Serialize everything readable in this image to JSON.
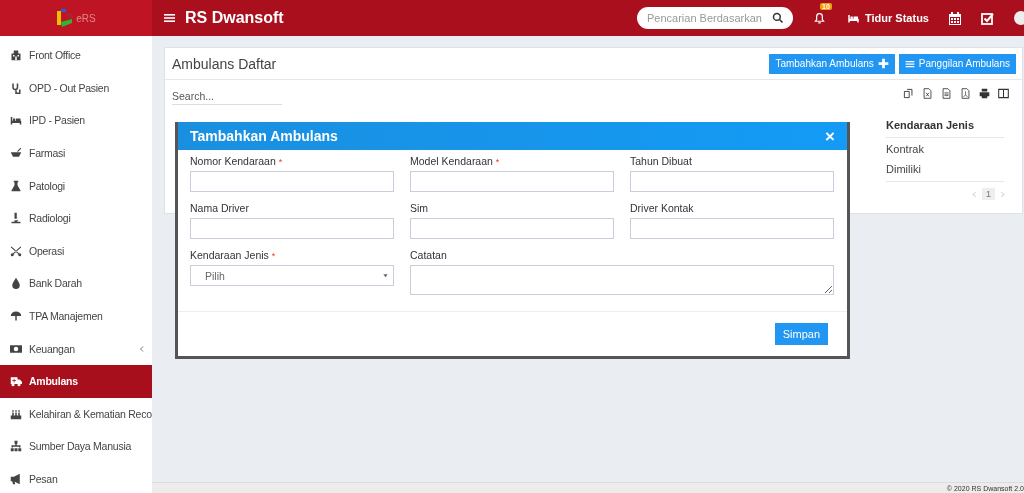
{
  "header": {
    "logo_text": "eRS",
    "title": "RS Dwansoft",
    "search": {
      "placeholder": "Pencarian Berdasarkan"
    },
    "notification_count": "10",
    "bed_status": "Tidur Status"
  },
  "sidebar": {
    "items": [
      {
        "label": "Front Office",
        "selected": false,
        "has_submenu": false
      },
      {
        "label": "OPD - Out Pasien",
        "selected": false,
        "has_submenu": false
      },
      {
        "label": "IPD - Pasien",
        "selected": false,
        "has_submenu": false
      },
      {
        "label": "Farmasi",
        "selected": false,
        "has_submenu": false
      },
      {
        "label": "Patologi",
        "selected": false,
        "has_submenu": false
      },
      {
        "label": "Radiologi",
        "selected": false,
        "has_submenu": false
      },
      {
        "label": "Operasi",
        "selected": false,
        "has_submenu": false
      },
      {
        "label": "Bank Darah",
        "selected": false,
        "has_submenu": false
      },
      {
        "label": "TPA Manajemen",
        "selected": false,
        "has_submenu": false
      },
      {
        "label": "Keuangan",
        "selected": false,
        "has_submenu": true
      },
      {
        "label": "Ambulans",
        "selected": true,
        "has_submenu": false
      },
      {
        "label": "Kelahiran & Kematian Reco",
        "selected": false,
        "has_submenu": false
      },
      {
        "label": "Sumber Daya Manusia",
        "selected": false,
        "has_submenu": false
      },
      {
        "label": "Pesan",
        "selected": false,
        "has_submenu": false
      }
    ]
  },
  "panel": {
    "title": "Ambulans Daftar",
    "buttons": [
      {
        "label": "Tambahkan Ambulans",
        "kind": "add"
      },
      {
        "label": "Panggilan Ambulans",
        "kind": "list"
      }
    ],
    "search": {
      "placeholder": "Search..."
    },
    "table": {
      "columns": [
        "Kendaraan Jenis"
      ],
      "rows": [
        [
          "Kontrak"
        ],
        [
          "Dimiliki"
        ]
      ]
    },
    "pagination": [
      {
        "label": "1",
        "selected": true
      }
    ]
  },
  "modal": {
    "title": "Tambahkan Ambulans",
    "close": "×",
    "fields": [
      {
        "label": "Nomor Kendaraan",
        "required_mark": "*",
        "kind": "text"
      },
      {
        "label": "Model Kendaraan",
        "required_mark": "*",
        "kind": "text"
      },
      {
        "label": "Tahun Dibuat",
        "kind": "text"
      },
      {
        "label": "Nama Driver",
        "kind": "text"
      },
      {
        "label": "Sim",
        "kind": "text"
      },
      {
        "label": "Driver Kontak",
        "kind": "text"
      },
      {
        "label": "Kendaraan Jenis",
        "required_mark": "*",
        "kind": "select",
        "value": "Pilih"
      },
      {
        "label": "Catatan",
        "kind": "textarea"
      }
    ],
    "submit": "Simpan"
  },
  "footer": "© 2020 RS Dwansoft 2.0"
}
